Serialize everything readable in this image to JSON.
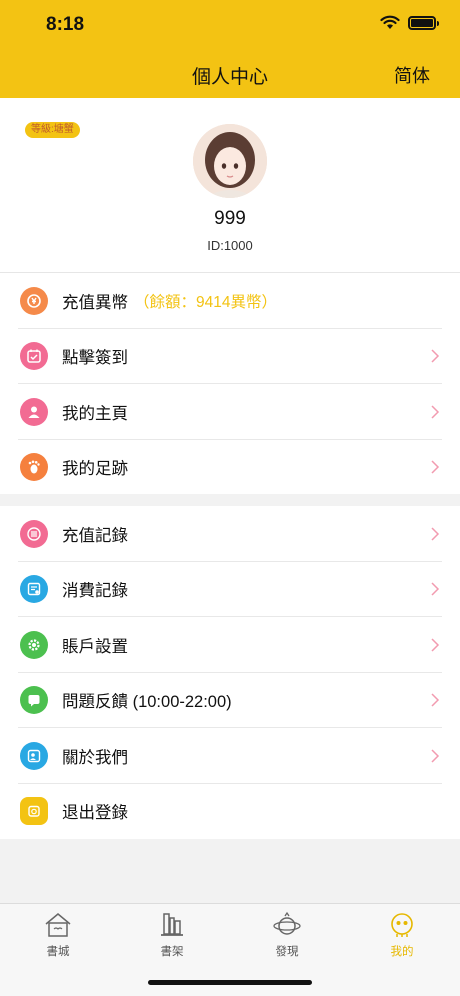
{
  "status_bar": {
    "time": "8:18"
  },
  "header": {
    "title": "個人中心",
    "lang_button": "简体"
  },
  "profile": {
    "level_badge": "等級:塘蟹",
    "name": "999",
    "user_id": "ID:1000"
  },
  "menu_primary": [
    {
      "label": "充值異幣",
      "extra": "（餘額：9414異幣）",
      "icon": "coin-icon",
      "color": "#f58a4a",
      "chevron": false
    },
    {
      "label": "點擊簽到",
      "icon": "calendar-check-icon",
      "color": "#f26b93",
      "chevron": true
    },
    {
      "label": "我的主頁",
      "icon": "user-icon",
      "color": "#f26b93",
      "chevron": true
    },
    {
      "label": "我的足跡",
      "icon": "footprint-icon",
      "color": "#f5803e",
      "chevron": true
    }
  ],
  "menu_secondary": [
    {
      "label": "充值記錄",
      "icon": "list-icon",
      "color": "#f26b93",
      "chevron": true
    },
    {
      "label": "消費記錄",
      "icon": "receipt-icon",
      "color": "#29a8e3",
      "chevron": true
    },
    {
      "label": "賬戶設置",
      "icon": "gear-icon",
      "color": "#4cc04f",
      "chevron": true
    },
    {
      "label": "問題反饋 (10:00-22:00)",
      "icon": "feedback-icon",
      "color": "#4cc04f",
      "chevron": true
    },
    {
      "label": "關於我們",
      "icon": "about-icon",
      "color": "#29a8e3",
      "chevron": true
    },
    {
      "label": "退出登錄",
      "icon": "logout-icon",
      "color": "#f3c313",
      "chevron": false
    }
  ],
  "tabbar": [
    {
      "label": "書城",
      "icon": "bookstore-icon",
      "active": false
    },
    {
      "label": "書架",
      "icon": "bookshelf-icon",
      "active": false
    },
    {
      "label": "發現",
      "icon": "discover-icon",
      "active": false
    },
    {
      "label": "我的",
      "icon": "profile-icon",
      "active": true
    }
  ],
  "colors": {
    "accent": "#f3c313",
    "chevron": "#f29bb0"
  }
}
